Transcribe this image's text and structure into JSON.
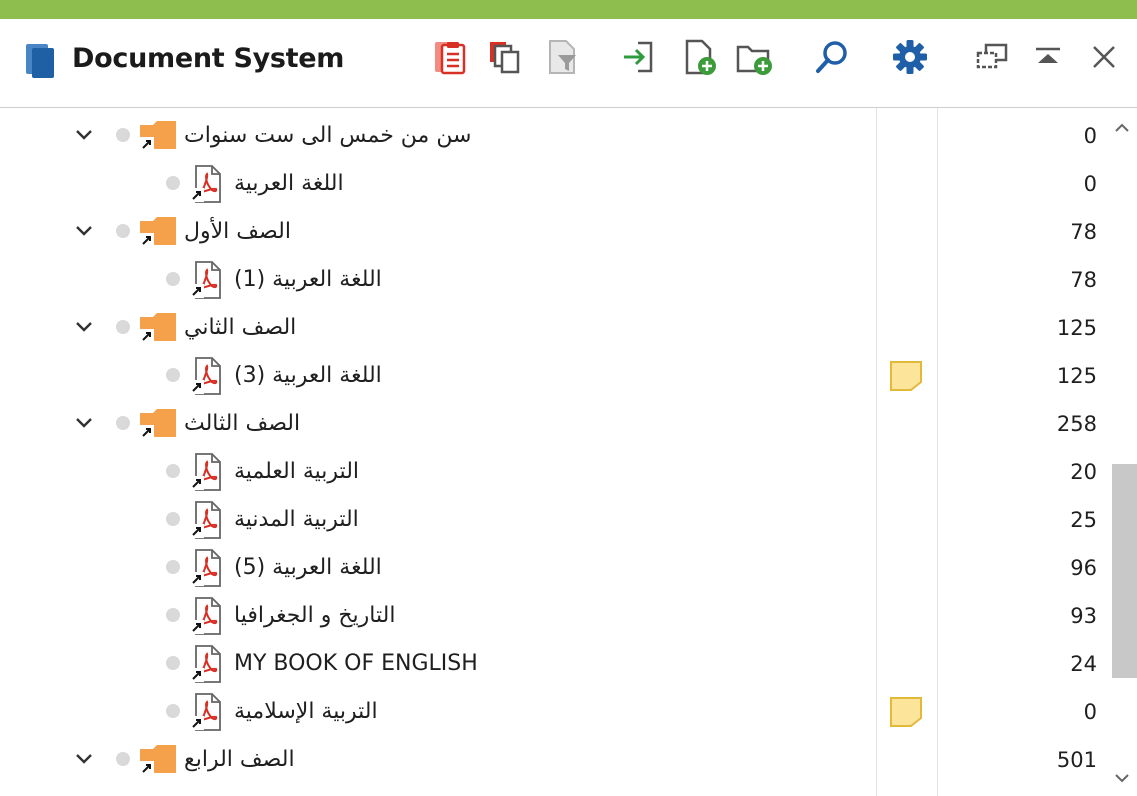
{
  "app": {
    "title": "Document System",
    "accent_color": "#8ebe4e",
    "folder_color": "#f5a04b",
    "memo_color": "#fde49b"
  },
  "toolbar": {
    "icons": [
      "clipboard-list-icon",
      "copy-documents-icon",
      "filter-document-icon",
      "import-icon",
      "new-document-icon",
      "new-folder-icon",
      "search-icon",
      "settings-icon",
      "undock-window-icon",
      "collapse-icon",
      "close-icon"
    ]
  },
  "tree": {
    "rows": [
      {
        "type": "folder",
        "label": "سن من خمس الى ست سنوات",
        "count": "0",
        "memo": false
      },
      {
        "type": "pdf",
        "label": "اللغة العربية",
        "count": "0",
        "memo": false
      },
      {
        "type": "folder",
        "label": "الصف الأول",
        "count": "78",
        "memo": false
      },
      {
        "type": "pdf",
        "label": "اللغة العربية (1)",
        "count": "78",
        "memo": false
      },
      {
        "type": "folder",
        "label": "الصف الثاني",
        "count": "125",
        "memo": false
      },
      {
        "type": "pdf",
        "label": "اللغة العربية (3)",
        "count": "125",
        "memo": true
      },
      {
        "type": "folder",
        "label": "الصف الثالث",
        "count": "258",
        "memo": false
      },
      {
        "type": "pdf",
        "label": "التربية العلمية",
        "count": "20",
        "memo": false
      },
      {
        "type": "pdf",
        "label": "التربية المدنية",
        "count": "25",
        "memo": false
      },
      {
        "type": "pdf",
        "label": "اللغة العربية (5)",
        "count": "96",
        "memo": false
      },
      {
        "type": "pdf",
        "label": "التاريخ و الجغرافيا",
        "count": "93",
        "memo": false
      },
      {
        "type": "pdf",
        "label": "MY BOOK OF ENGLISH",
        "count": "24",
        "memo": false
      },
      {
        "type": "pdf",
        "label": "التربية الإسلامية",
        "count": "0",
        "memo": true
      },
      {
        "type": "folder",
        "label": "الصف الرابع",
        "count": "501",
        "memo": false
      }
    ]
  }
}
